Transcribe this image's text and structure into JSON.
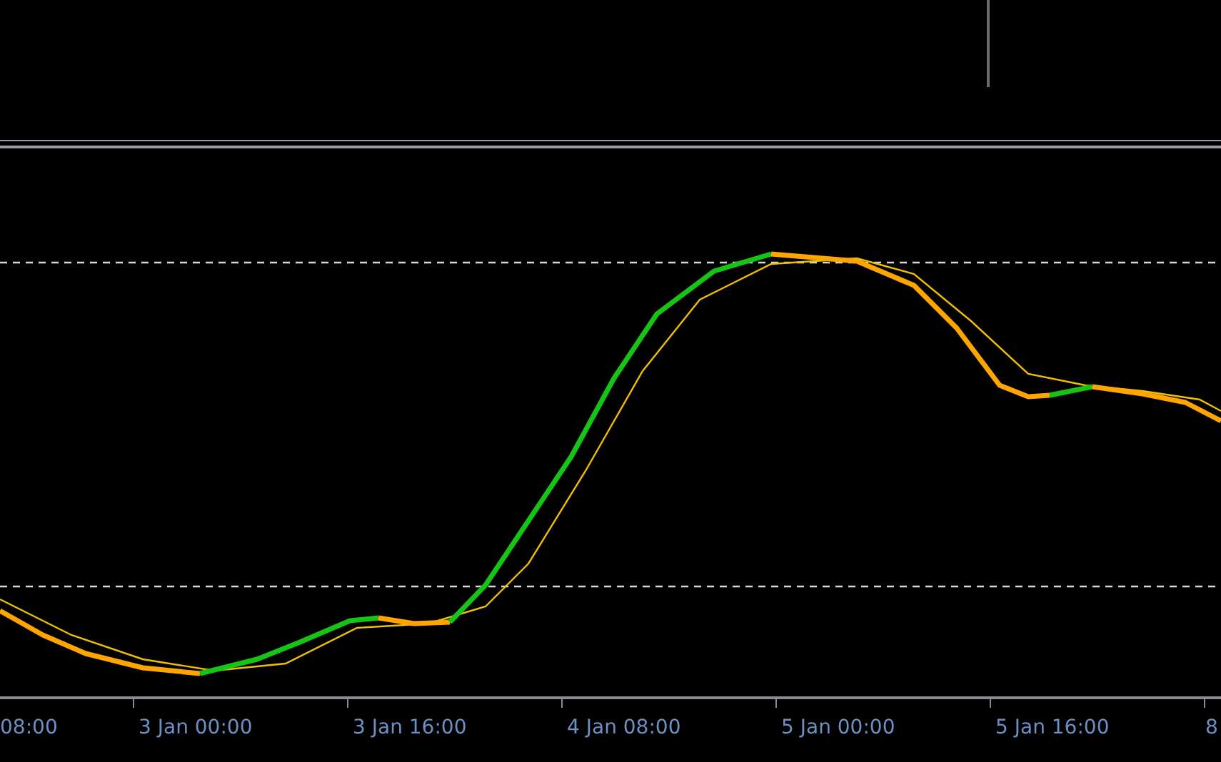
{
  "time_axis": {
    "labels": [
      "08:00",
      "3 Jan 00:00",
      "3 Jan 16:00",
      "4 Jan 08:00",
      "5 Jan 00:00",
      "5 Jan 16:00",
      "8"
    ]
  }
}
